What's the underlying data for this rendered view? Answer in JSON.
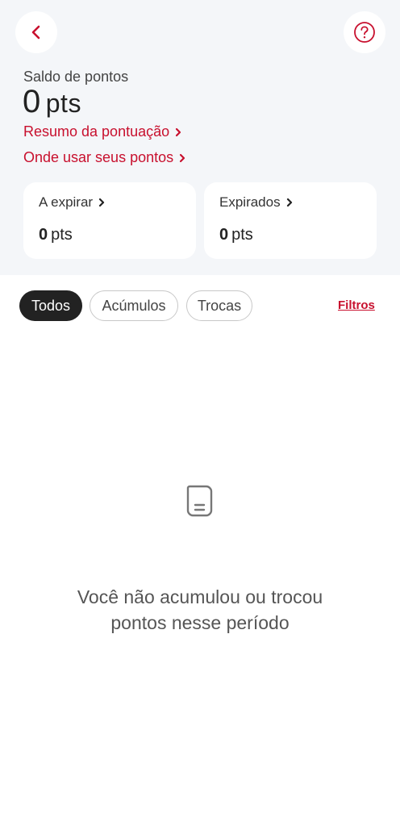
{
  "header": {
    "back_icon": "chevron-left-icon",
    "help_icon": "question-circle-icon"
  },
  "balance": {
    "label": "Saldo de pontos",
    "value": "0",
    "unit": "pts"
  },
  "links": {
    "summary": "Resumo da pontuação",
    "where_to_use": "Onde usar seus pontos"
  },
  "cards": {
    "expiring": {
      "title": "A expirar",
      "value": "0",
      "unit": "pts"
    },
    "expired": {
      "title": "Expirados",
      "value": "0",
      "unit": "pts"
    }
  },
  "filters": {
    "chips": [
      "Todos",
      "Acúmulos",
      "Trocas"
    ],
    "selected": "Todos",
    "filters_link": "Filtros"
  },
  "empty_state": {
    "icon": "document-icon",
    "line1": "Você não acumulou ou trocou",
    "line2": "pontos nesse período"
  },
  "colors": {
    "accent": "#c8102e",
    "header_bg": "#f4f6f9",
    "chip_selected_bg": "#222222"
  }
}
